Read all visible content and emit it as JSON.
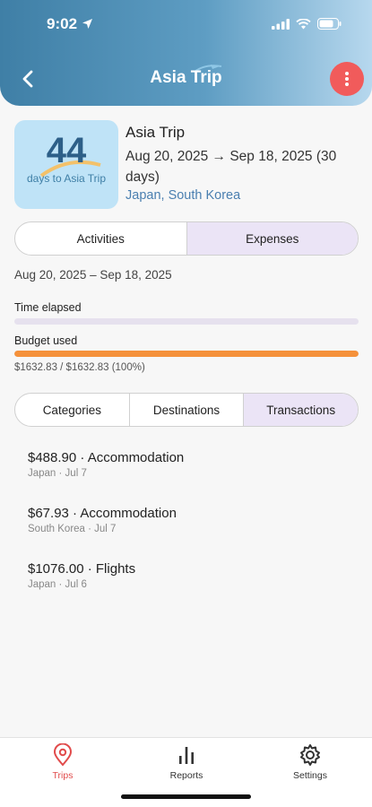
{
  "status_bar": {
    "time": "9:02"
  },
  "header": {
    "title": "Asia Trip"
  },
  "trip": {
    "countdown": "44",
    "countdown_caption": "days to Asia Trip",
    "name": "Asia Trip",
    "dates": "Aug 20, 2025 → Sep 18, 2025 (30 days)",
    "places": "Japan, South Korea"
  },
  "view_tabs": [
    {
      "label": "Activities",
      "active": false
    },
    {
      "label": "Expenses",
      "active": true
    }
  ],
  "date_range": "Aug 20, 2025 – Sep 18, 2025",
  "progress": {
    "time_label": "Time elapsed",
    "time_fraction": 0,
    "budget_label": "Budget used",
    "budget_fraction": 1.0,
    "budget_text": "$1632.83 / $1632.83 (100%)",
    "time_color": "#e6e1ee",
    "budget_color": "#f5913a"
  },
  "expense_tabs": [
    {
      "label": "Categories",
      "active": false
    },
    {
      "label": "Destinations",
      "active": false
    },
    {
      "label": "Transactions",
      "active": true
    }
  ],
  "transactions": [
    {
      "title": "$488.90 · Accommodation",
      "meta": "Japan · Jul 7"
    },
    {
      "title": "$67.93 · Accommodation",
      "meta": "South Korea · Jul 7"
    },
    {
      "title": "$1076.00 · Flights",
      "meta": "Japan · Jul 6"
    }
  ],
  "tab_bar": {
    "trips": "Trips",
    "reports": "Reports",
    "settings": "Settings",
    "active_color": "#e14b4b"
  },
  "colors": {
    "accent": "#f15b5b",
    "header_start": "#3f7fa6",
    "active_segment": "#ebe4f6"
  }
}
